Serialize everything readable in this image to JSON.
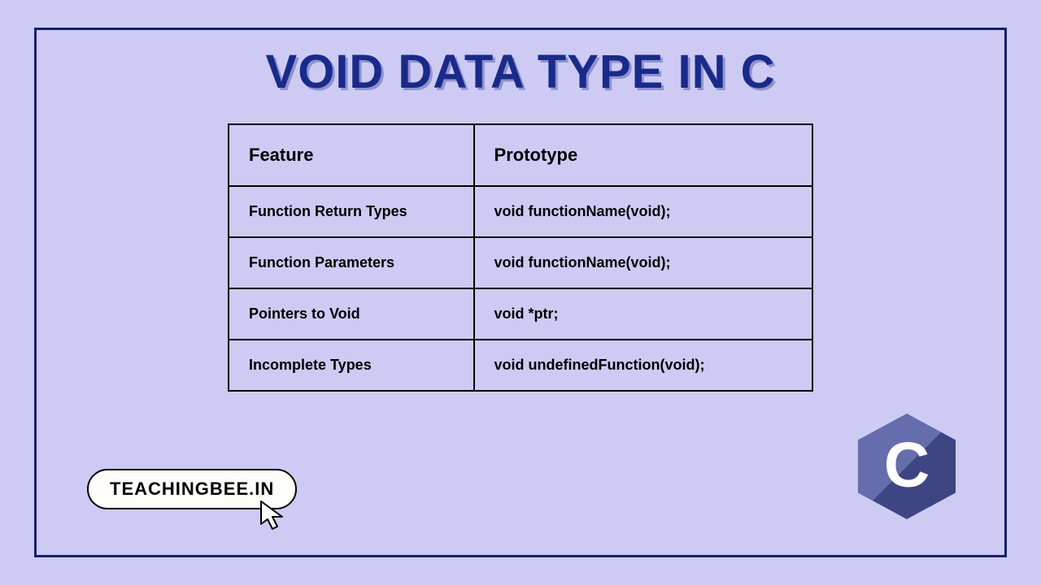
{
  "title": "VOID DATA TYPE IN C",
  "table": {
    "headers": {
      "feature": "Feature",
      "prototype": "Prototype"
    },
    "rows": [
      {
        "feature": "Function Return Types",
        "prototype": "void functionName(void);"
      },
      {
        "feature": "Function Parameters",
        "prototype": "void functionName(void);"
      },
      {
        "feature": "Pointers to Void",
        "prototype": "void *ptr;"
      },
      {
        "feature": "Incomplete Types",
        "prototype": "void undefinedFunction(void);"
      }
    ]
  },
  "badge": "TEACHINGBEE.IN",
  "logo_letter": "C"
}
